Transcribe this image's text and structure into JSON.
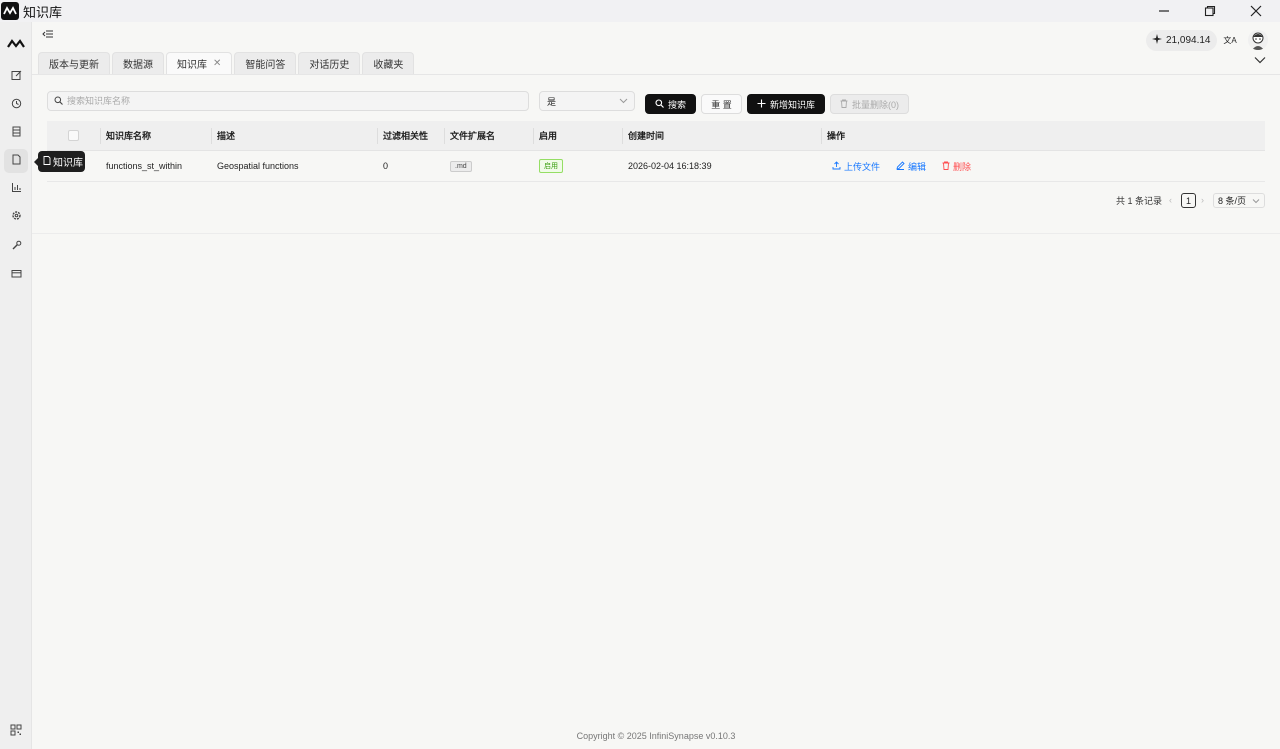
{
  "window": {
    "title": "知识库"
  },
  "sidebar": {
    "items": [
      {
        "name": "edit-icon"
      },
      {
        "name": "history-icon"
      },
      {
        "name": "database-icon"
      },
      {
        "name": "document-icon",
        "active": true
      },
      {
        "name": "chart-icon"
      },
      {
        "name": "gear-icon"
      },
      {
        "name": "tool-icon"
      },
      {
        "name": "card-icon"
      }
    ],
    "tooltip": "知识库"
  },
  "header": {
    "balance": "21,094.14",
    "lang_icon": "文A"
  },
  "tabs": [
    {
      "label": "版本与更新"
    },
    {
      "label": "数据源"
    },
    {
      "label": "知识库",
      "active": true,
      "closable": true
    },
    {
      "label": "智能问答"
    },
    {
      "label": "对话历史"
    },
    {
      "label": "收藏夹"
    }
  ],
  "toolbar": {
    "search_placeholder": "搜索知识库名称",
    "select_value": "是",
    "search_label": "搜索",
    "reset_label": "重 置",
    "add_label": "新增知识库",
    "batch_delete_label": "批量删除(0)"
  },
  "table": {
    "columns": [
      "知识库名称",
      "描述",
      "过滤相关性",
      "文件扩展名",
      "启用",
      "创建时间",
      "操作"
    ],
    "rows": [
      {
        "name": "functions_st_within",
        "description": "Geospatial functions",
        "relevance": "0",
        "extension": ".md",
        "enabled": "启用",
        "created": "2026-02-04 16:18:39",
        "actions": {
          "upload": "上传文件",
          "edit": "编辑",
          "delete": "删除"
        }
      }
    ]
  },
  "pagination": {
    "total_text": "共 1 条记录",
    "page": "1",
    "page_size": "8 条/页"
  },
  "footer": {
    "copyright": "Copyright © 2025 InfiniSynapse v0.10.3"
  },
  "colors": {
    "primary": "#111111",
    "link": "#1677ff",
    "danger": "#ff4d4f",
    "success": "#389e0d"
  }
}
